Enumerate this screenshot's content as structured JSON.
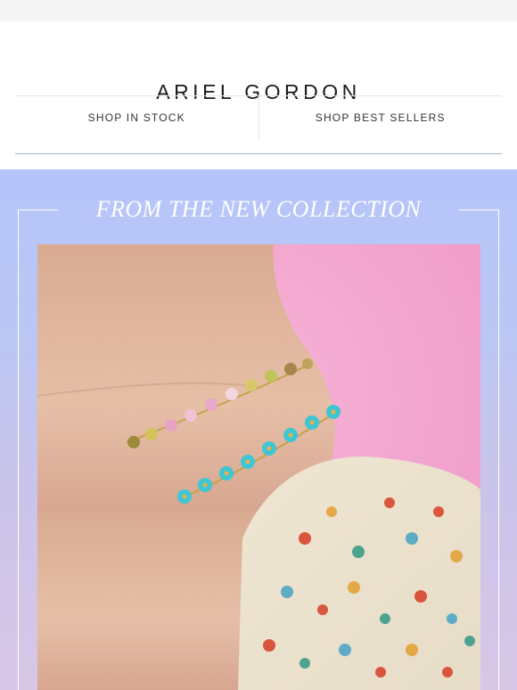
{
  "header": {
    "brand": "ARIEL GORDON",
    "nav": [
      {
        "label": "SHOP IN STOCK"
      },
      {
        "label": "SHOP BEST SELLERS"
      }
    ]
  },
  "hero": {
    "title": "FROM THE NEW COLLECTION",
    "image_alt": "Wrist wearing pink-gold and turquoise flower bracelets against pink background",
    "colors": {
      "background_top": "#b6c4fb",
      "background_bottom": "#d8c6e6",
      "photo_background": "#f2a6cf",
      "turquoise": "#3dc6d3"
    }
  }
}
